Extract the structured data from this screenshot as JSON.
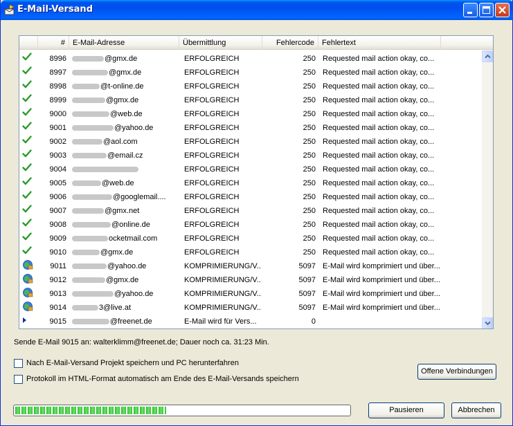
{
  "window": {
    "title": "E-Mail-Versand"
  },
  "columns": {
    "num": "#",
    "email": "E-Mail-Adresse",
    "transfer": "Übermittlung",
    "code": "Fehlercode",
    "error": "Fehlertext"
  },
  "rows": [
    {
      "status": "success",
      "num": "8996",
      "email_visible": "@gmx.de",
      "transfer": "ERFOLGREICH",
      "code": "250",
      "error": "Requested mail action okay, co..."
    },
    {
      "status": "success",
      "num": "8997",
      "email_visible": "@gmx.de",
      "transfer": "ERFOLGREICH",
      "code": "250",
      "error": "Requested mail action okay, co..."
    },
    {
      "status": "success",
      "num": "8998",
      "email_visible": "@t-online.de",
      "transfer": "ERFOLGREICH",
      "code": "250",
      "error": "Requested mail action okay, co..."
    },
    {
      "status": "success",
      "num": "8999",
      "email_visible": "@gmx.de",
      "transfer": "ERFOLGREICH",
      "code": "250",
      "error": "Requested mail action okay, co..."
    },
    {
      "status": "success",
      "num": "9000",
      "email_visible": "@web.de",
      "transfer": "ERFOLGREICH",
      "code": "250",
      "error": "Requested mail action okay, co..."
    },
    {
      "status": "success",
      "num": "9001",
      "email_visible": "@yahoo.de",
      "transfer": "ERFOLGREICH",
      "code": "250",
      "error": "Requested mail action okay, co..."
    },
    {
      "status": "success",
      "num": "9002",
      "email_visible": "@aol.com",
      "transfer": "ERFOLGREICH",
      "code": "250",
      "error": "Requested mail action okay, co..."
    },
    {
      "status": "success",
      "num": "9003",
      "email_visible": "@email.cz",
      "transfer": "ERFOLGREICH",
      "code": "250",
      "error": "Requested mail action okay, co..."
    },
    {
      "status": "success",
      "num": "9004",
      "email_visible": "",
      "transfer": "ERFOLGREICH",
      "code": "250",
      "error": "Requested mail action okay, co..."
    },
    {
      "status": "success",
      "num": "9005",
      "email_visible": "@web.de",
      "transfer": "ERFOLGREICH",
      "code": "250",
      "error": "Requested mail action okay, co..."
    },
    {
      "status": "success",
      "num": "9006",
      "email_visible": "@googlemail....",
      "transfer": "ERFOLGREICH",
      "code": "250",
      "error": "Requested mail action okay, co..."
    },
    {
      "status": "success",
      "num": "9007",
      "email_visible": "@gmx.net",
      "transfer": "ERFOLGREICH",
      "code": "250",
      "error": "Requested mail action okay, co..."
    },
    {
      "status": "success",
      "num": "9008",
      "email_visible": "@online.de",
      "transfer": "ERFOLGREICH",
      "code": "250",
      "error": "Requested mail action okay, co..."
    },
    {
      "status": "success",
      "num": "9009",
      "email_visible": "ocketmail.com",
      "transfer": "ERFOLGREICH",
      "code": "250",
      "error": "Requested mail action okay, co..."
    },
    {
      "status": "success",
      "num": "9010",
      "email_visible": "@gmx.de",
      "transfer": "ERFOLGREICH",
      "code": "250",
      "error": "Requested mail action okay, co..."
    },
    {
      "status": "compress",
      "num": "9011",
      "email_visible": "@yahoo.de",
      "transfer": "KOMPRIMIERUNG/V...",
      "code": "5097",
      "error": "E-Mail wird komprimiert und über..."
    },
    {
      "status": "compress",
      "num": "9012",
      "email_visible": "@gmx.de",
      "transfer": "KOMPRIMIERUNG/V...",
      "code": "5097",
      "error": "E-Mail wird komprimiert und über..."
    },
    {
      "status": "compress",
      "num": "9013",
      "email_visible": "@yahoo.de",
      "transfer": "KOMPRIMIERUNG/V...",
      "code": "5097",
      "error": "E-Mail wird komprimiert und über..."
    },
    {
      "status": "compress",
      "num": "9014",
      "email_visible": "3@live.at",
      "transfer": "KOMPRIMIERUNG/V...",
      "code": "5097",
      "error": "E-Mail wird komprimiert und über..."
    },
    {
      "status": "sending",
      "num": "9015",
      "email_visible": "@freenet.de",
      "transfer": "E-Mail wird für Vers...",
      "code": "0",
      "error": ""
    }
  ],
  "status_text": "Sende E-Mail 9015 an: walterklimm@freenet.de; Dauer noch ca. 31:23 Min.",
  "options": {
    "shutdown_label": "Nach E-Mail-Versand Projekt speichern und PC herunterfahren",
    "html_log_label": "Protokoll im HTML-Format automatisch am Ende des E-Mail-Versands speichern"
  },
  "buttons": {
    "open_connections": "Offene Verbindungen",
    "pause": "Pausieren",
    "cancel": "Abbrechen"
  },
  "progress": {
    "fraction": 0.45
  },
  "colors": {
    "title_bar": "#0054e3",
    "progress": "#2fbd2f"
  }
}
